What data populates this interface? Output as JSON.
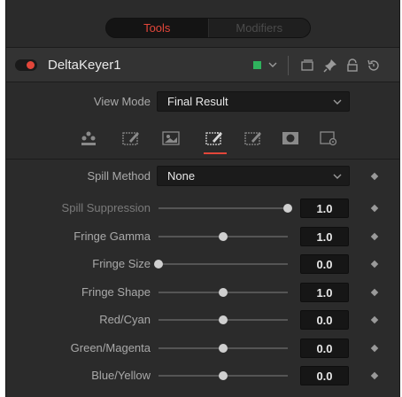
{
  "tabs": [
    {
      "label": "Tools",
      "active": true
    },
    {
      "label": "Modifiers",
      "active": false
    }
  ],
  "header": {
    "node_name": "DeltaKeyer1",
    "node_color": "#2fb35d",
    "icons": [
      "collapse-icon",
      "pin-icon",
      "lock-icon",
      "reset-icon"
    ]
  },
  "view_mode": {
    "label": "View Mode",
    "value": "Final Result"
  },
  "icon_tabs": [
    {
      "name": "key-tab-icon",
      "active": false
    },
    {
      "name": "pre-matte-tab-icon",
      "active": false
    },
    {
      "name": "matte-tab-icon",
      "active": false
    },
    {
      "name": "fine-tune-tab-icon",
      "active": true
    },
    {
      "name": "post-matte-tab-icon",
      "active": false
    },
    {
      "name": "mask-tab-icon",
      "active": false
    },
    {
      "name": "settings-tab-icon",
      "active": false
    }
  ],
  "spill_method": {
    "label": "Spill Method",
    "value": "None"
  },
  "sliders": [
    {
      "label": "Spill Suppression",
      "value": "1.0",
      "position": 1.0,
      "dimmed": true
    },
    {
      "label": "Fringe Gamma",
      "value": "1.0",
      "position": 0.5,
      "dimmed": false
    },
    {
      "label": "Fringe Size",
      "value": "0.0",
      "position": 0.0,
      "dimmed": false
    },
    {
      "label": "Fringe Shape",
      "value": "1.0",
      "position": 0.5,
      "dimmed": false
    },
    {
      "label": "Red/Cyan",
      "value": "0.0",
      "position": 0.5,
      "dimmed": false
    },
    {
      "label": "Green/Magenta",
      "value": "0.0",
      "position": 0.5,
      "dimmed": false
    },
    {
      "label": "Blue/Yellow",
      "value": "0.0",
      "position": 0.5,
      "dimmed": false
    }
  ],
  "colors": {
    "accent": "#e2463a",
    "background": "#2b2b2b"
  }
}
